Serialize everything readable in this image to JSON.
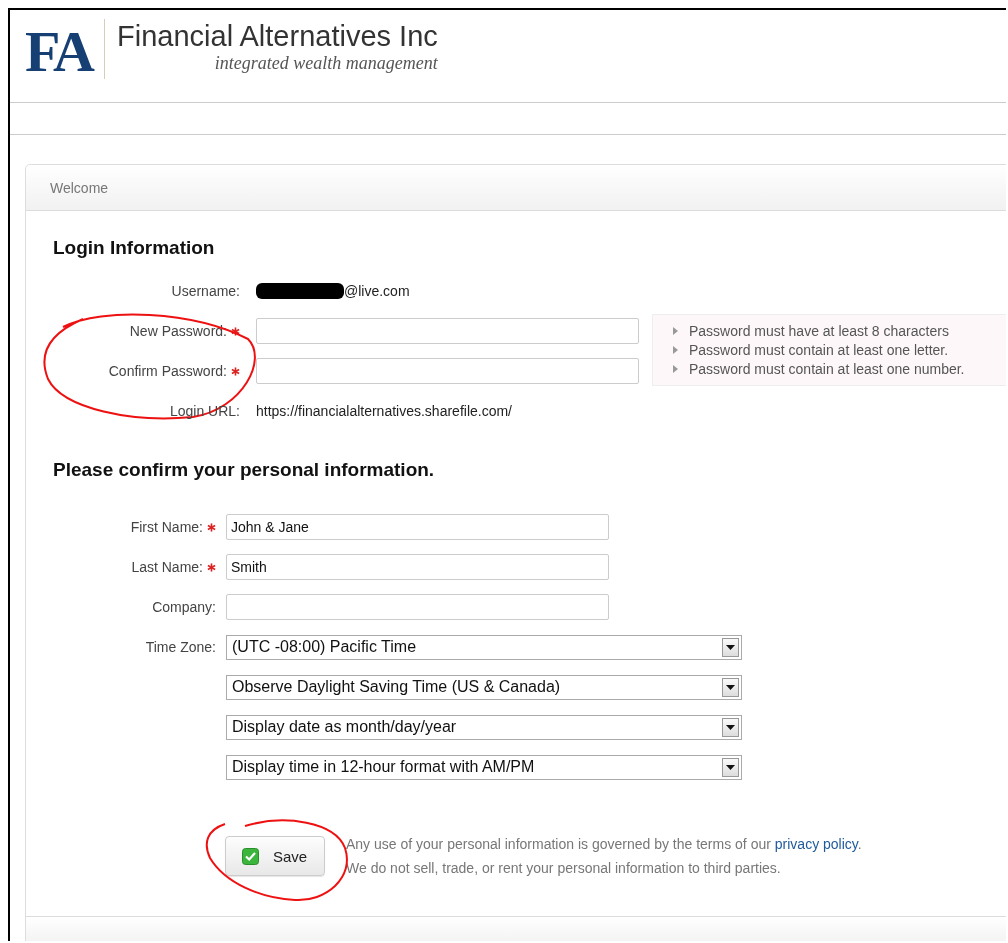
{
  "header": {
    "logo_mark": "FA",
    "company": "Financial Alternatives Inc",
    "tagline": "integrated wealth management"
  },
  "panel": {
    "title": "Welcome"
  },
  "login": {
    "heading": "Login Information",
    "fields": [
      {
        "kind": "static",
        "label": "Username:",
        "required": false,
        "redacted": true,
        "value": "@live.com",
        "circled": false
      },
      {
        "kind": "password",
        "label": "New Password:",
        "required": true,
        "circled": true
      },
      {
        "kind": "password",
        "label": "Confirm Password:",
        "required": true,
        "circled": true
      },
      {
        "kind": "static",
        "label": "Login URL:",
        "required": false,
        "redacted": false,
        "value": "https://financialalternatives.sharefile.com/",
        "circled": false
      }
    ],
    "requirements": [
      "Password must have at least 8 characters",
      "Password must contain at least one letter.",
      "Password must contain at least one number."
    ]
  },
  "personal": {
    "heading": "Please confirm your personal information.",
    "fields": [
      {
        "kind": "text",
        "label": "First Name:",
        "required": true,
        "value": "John & Jane"
      },
      {
        "kind": "text",
        "label": "Last Name:",
        "required": true,
        "value": "Smith"
      },
      {
        "kind": "text",
        "label": "Company:",
        "required": false
      },
      {
        "kind": "select",
        "label": "Time Zone:",
        "required": false,
        "value": "(UTC -08:00) Pacific Time"
      },
      {
        "kind": "select",
        "required": false,
        "value": "Observe Daylight Saving Time (US & Canada)"
      },
      {
        "kind": "select",
        "required": false,
        "value": "Display date as month/day/year"
      },
      {
        "kind": "select",
        "required": false,
        "value": "Display time in 12-hour format with AM/PM"
      }
    ]
  },
  "footer": {
    "save": {
      "label": "Save",
      "circled": true
    },
    "notice_before": "Any use of your personal information is governed by the terms of our ",
    "notice_link": "privacy policy",
    "notice_after": ".",
    "notice_second": "We do not sell, trade, or rent your personal information to third parties."
  }
}
